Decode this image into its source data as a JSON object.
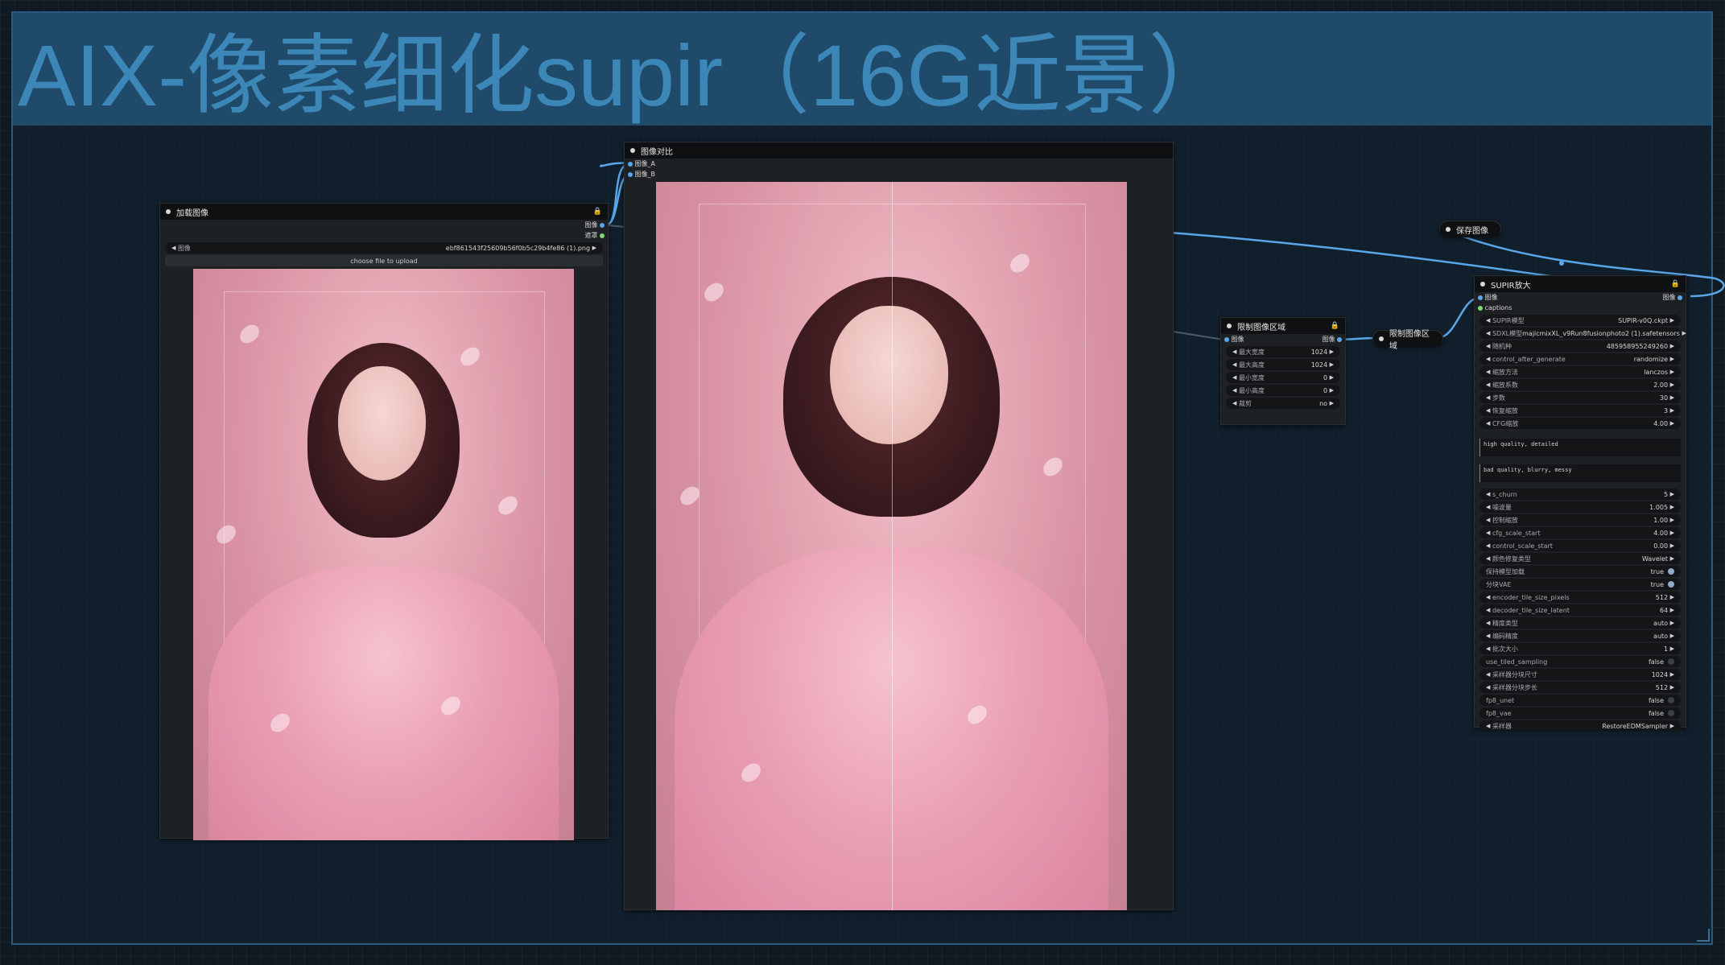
{
  "group": {
    "title": "AIX-像素细化supir（16G近景）"
  },
  "load_image": {
    "title": "加载图像",
    "outputs": [
      "图像",
      "遮罩"
    ],
    "image_widget": {
      "label": "图像",
      "value": "ebf861543f25609b56f0b5c29b4fe86 (1).png"
    },
    "upload_button": "choose file to upload"
  },
  "compare": {
    "title": "图像对比",
    "inputs": [
      "图像_A",
      "图像_B"
    ]
  },
  "save_image": {
    "title": "保存图像"
  },
  "limit_region": {
    "title": "限制图像区域",
    "io_label": "图像",
    "widgets": [
      {
        "label": "最大宽度",
        "value": "1024"
      },
      {
        "label": "最大高度",
        "value": "1024"
      },
      {
        "label": "最小宽度",
        "value": "0"
      },
      {
        "label": "最小高度",
        "value": "0"
      },
      {
        "label": "裁剪",
        "value": "no"
      }
    ]
  },
  "limit_region_collapsed": {
    "title": "限制图像区域"
  },
  "supir": {
    "title": "SUPIR放大",
    "input_label": "图像",
    "output_label": "图像",
    "captions_label": "captions",
    "widgets_top": [
      {
        "label": "SUPIR模型",
        "value": "SUPIR-v0Q.ckpt"
      },
      {
        "label": "SDXL模型",
        "value": "majicmixXL_v9Run8fusionphoto2 (1).safetensors"
      },
      {
        "label": "随机种",
        "value": "485958955249260"
      },
      {
        "label": "control_after_generate",
        "value": "randomize"
      },
      {
        "label": "缩放方法",
        "value": "lanczos"
      },
      {
        "label": "缩放系数",
        "value": "2.00"
      },
      {
        "label": "步数",
        "value": "30"
      },
      {
        "label": "恢复缩放",
        "value": "3"
      },
      {
        "label": "CFG缩放",
        "value": "4.00"
      }
    ],
    "positive_prompt": "high quality, detailed",
    "negative_prompt": "bad quality, blurry, messy",
    "widgets_bottom": [
      {
        "label": "s_churn",
        "value": "5",
        "kind": "num"
      },
      {
        "label": "噪波量",
        "value": "1.005",
        "kind": "num"
      },
      {
        "label": "控制缩放",
        "value": "1.00",
        "kind": "num"
      },
      {
        "label": "cfg_scale_start",
        "value": "4.00",
        "kind": "num"
      },
      {
        "label": "control_scale_start",
        "value": "0.00",
        "kind": "num"
      },
      {
        "label": "颜色修复类型",
        "value": "Wavelet",
        "kind": "num"
      },
      {
        "label": "保持模型加载",
        "value": "true",
        "kind": "toggle_on"
      },
      {
        "label": "分块VAE",
        "value": "true",
        "kind": "toggle_on"
      },
      {
        "label": "encoder_tile_size_pixels",
        "value": "512",
        "kind": "num"
      },
      {
        "label": "decoder_tile_size_latent",
        "value": "64",
        "kind": "num"
      },
      {
        "label": "精度类型",
        "value": "auto",
        "kind": "num"
      },
      {
        "label": "编码精度",
        "value": "auto",
        "kind": "num"
      },
      {
        "label": "批次大小",
        "value": "1",
        "kind": "num"
      },
      {
        "label": "use_tiled_sampling",
        "value": "false",
        "kind": "toggle_off"
      },
      {
        "label": "采样器分块尺寸",
        "value": "1024",
        "kind": "num"
      },
      {
        "label": "采样器分块步长",
        "value": "512",
        "kind": "num"
      },
      {
        "label": "fp8_unet",
        "value": "false",
        "kind": "toggle_off"
      },
      {
        "label": "fp8_vae",
        "value": "false",
        "kind": "toggle_off"
      },
      {
        "label": "采样器",
        "value": "RestoreEDMSampler",
        "kind": "num"
      }
    ]
  },
  "colors": {
    "group_border": "#2c5a7e",
    "group_header": "#1f4a6a",
    "title_text": "#3d86b8",
    "link_image": "#5aa6ea",
    "link_mask": "#7bdc6e"
  }
}
